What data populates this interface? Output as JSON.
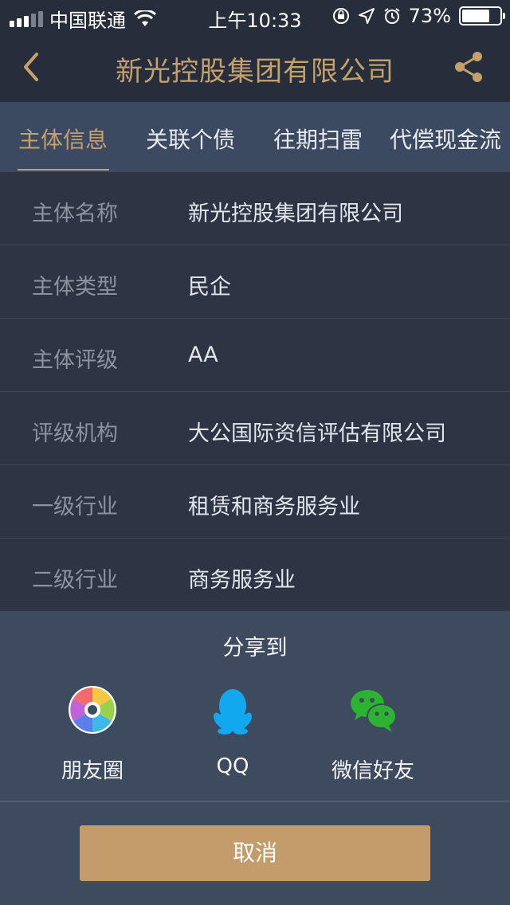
{
  "status_bar": {
    "carrier": "中国联通",
    "time": "上午10:33",
    "battery": "73%",
    "battery_level": 0.73
  },
  "nav": {
    "title": "新光控股集团有限公司",
    "back_icon": "chevron-left-icon",
    "share_icon": "share-icon"
  },
  "tabs": [
    {
      "label": "主体信息",
      "active": true
    },
    {
      "label": "关联个债",
      "active": false
    },
    {
      "label": "往期扫雷",
      "active": false
    },
    {
      "label": "代偿现金流",
      "active": false
    }
  ],
  "info_rows": [
    {
      "label": "主体名称",
      "value": "新光控股集团有限公司"
    },
    {
      "label": "主体类型",
      "value": "民企"
    },
    {
      "label": "主体评级",
      "value": "AA"
    },
    {
      "label": "评级机构",
      "value": "大公国际资信评估有限公司"
    },
    {
      "label": "一级行业",
      "value": "租赁和商务服务业"
    },
    {
      "label": "二级行业",
      "value": "商务服务业"
    }
  ],
  "share_sheet": {
    "title": "分享到",
    "options": [
      {
        "label": "朋友圈",
        "icon": "moments-icon"
      },
      {
        "label": "QQ",
        "icon": "qq-icon"
      },
      {
        "label": "微信好友",
        "icon": "wechat-icon"
      }
    ],
    "cancel_label": "取消"
  },
  "colors": {
    "accent": "#c6a06b",
    "nav_bg": "#262e3c",
    "tab_bg": "#3b4a60",
    "list_bg": "#2d3544",
    "sheet_bg": "#3e4a5e",
    "cancel_bg": "#c49c6b"
  }
}
